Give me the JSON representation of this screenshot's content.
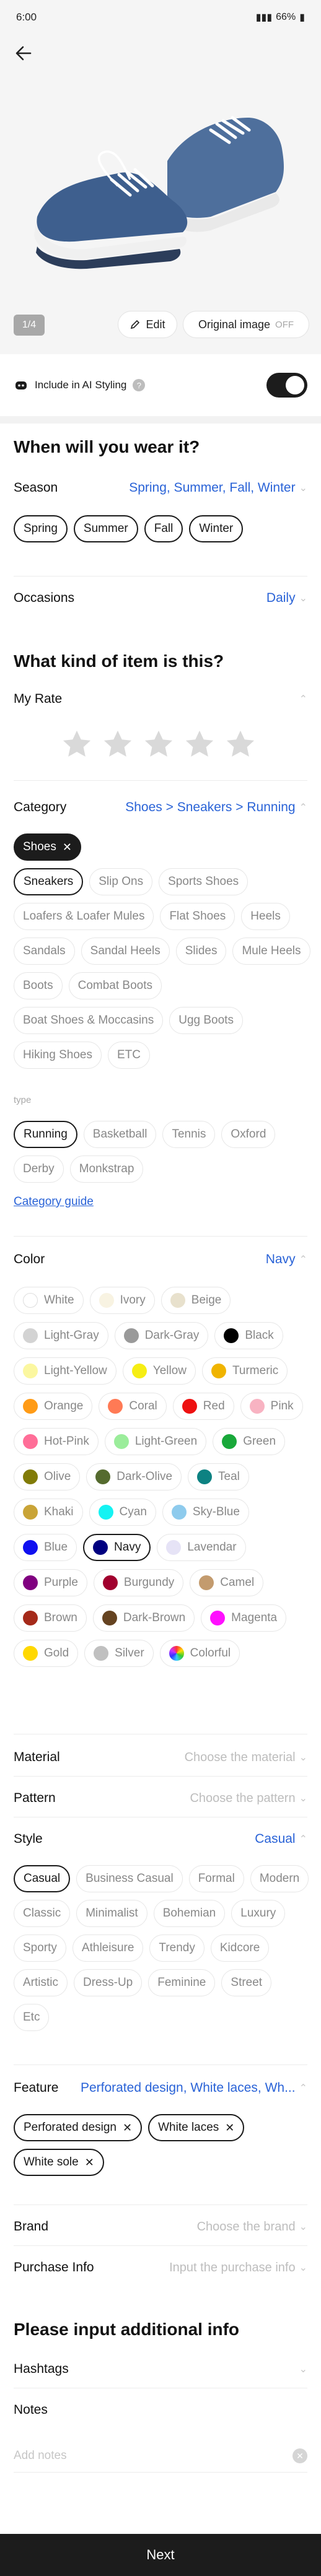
{
  "status": {
    "time": "6:00",
    "battery": "66%"
  },
  "hero": {
    "counter": "1/4",
    "edit": "Edit",
    "original": "Original image",
    "original_state": "OFF"
  },
  "ai": {
    "label": "Include in AI Styling",
    "help": "?"
  },
  "wear": {
    "heading": "When will you wear it?",
    "season_label": "Season",
    "season_value": "Spring, Summer, Fall, Winter",
    "seasons": [
      "Spring",
      "Summer",
      "Fall",
      "Winter"
    ],
    "occasions_label": "Occasions",
    "occasions_value": "Daily"
  },
  "kind": {
    "heading": "What kind of item is this?",
    "rate_label": "My Rate",
    "rating": 0,
    "rating_max": 5
  },
  "category": {
    "label": "Category",
    "value": "Shoes > Sneakers > Running",
    "top": "Shoes",
    "subs": [
      "Sneakers",
      "Slip Ons",
      "Sports Shoes",
      "Loafers & Loafer Mules",
      "Flat Shoes",
      "Heels",
      "Sandals",
      "Sandal Heels",
      "Slides",
      "Mule Heels",
      "Boots",
      "Combat Boots",
      "Boat Shoes & Moccasins",
      "Ugg Boots",
      "Hiking Shoes",
      "ETC"
    ],
    "sub_selected": "Sneakers",
    "type_label": "type",
    "types": [
      "Running",
      "Basketball",
      "Tennis",
      "Oxford",
      "Derby",
      "Monkstrap"
    ],
    "type_selected": "Running",
    "guide": "Category guide"
  },
  "color": {
    "label": "Color",
    "value": "Navy",
    "selected": "Navy",
    "items": [
      {
        "name": "White",
        "hex": "#ffffff"
      },
      {
        "name": "Ivory",
        "hex": "#f8f3e2"
      },
      {
        "name": "Beige",
        "hex": "#e8e1cd"
      },
      {
        "name": "Light-Gray",
        "hex": "#d3d3d3"
      },
      {
        "name": "Dark-Gray",
        "hex": "#9a9a9a"
      },
      {
        "name": "Black",
        "hex": "#000000"
      },
      {
        "name": "Light-Yellow",
        "hex": "#fbf7a0"
      },
      {
        "name": "Yellow",
        "hex": "#f6ee14"
      },
      {
        "name": "Turmeric",
        "hex": "#f0b400"
      },
      {
        "name": "Orange",
        "hex": "#ff9b16"
      },
      {
        "name": "Coral",
        "hex": "#ff7a55"
      },
      {
        "name": "Red",
        "hex": "#ee1111"
      },
      {
        "name": "Pink",
        "hex": "#f8b3c2"
      },
      {
        "name": "Hot-Pink",
        "hex": "#ff6e98"
      },
      {
        "name": "Light-Green",
        "hex": "#9bed9b"
      },
      {
        "name": "Green",
        "hex": "#19a83a"
      },
      {
        "name": "Olive",
        "hex": "#817b07"
      },
      {
        "name": "Dark-Olive",
        "hex": "#556b2f"
      },
      {
        "name": "Teal",
        "hex": "#0d8282"
      },
      {
        "name": "Khaki",
        "hex": "#c9a437"
      },
      {
        "name": "Cyan",
        "hex": "#14f3f3"
      },
      {
        "name": "Sky-Blue",
        "hex": "#8ecbed"
      },
      {
        "name": "Blue",
        "hex": "#1010f0"
      },
      {
        "name": "Navy",
        "hex": "#000080"
      },
      {
        "name": "Lavendar",
        "hex": "#e6e3f6"
      },
      {
        "name": "Purple",
        "hex": "#800080"
      },
      {
        "name": "Burgundy",
        "hex": "#a1002e"
      },
      {
        "name": "Camel",
        "hex": "#c39b6e"
      },
      {
        "name": "Brown",
        "hex": "#a52a1a"
      },
      {
        "name": "Dark-Brown",
        "hex": "#654321"
      },
      {
        "name": "Magenta",
        "hex": "#ff10ff"
      },
      {
        "name": "Gold",
        "hex": "#ffd800"
      },
      {
        "name": "Silver",
        "hex": "#c0c0c0"
      },
      {
        "name": "Colorful",
        "hex": "conic"
      }
    ]
  },
  "material": {
    "label": "Material",
    "placeholder": "Choose the material"
  },
  "pattern": {
    "label": "Pattern",
    "placeholder": "Choose the pattern"
  },
  "style": {
    "label": "Style",
    "value": "Casual",
    "selected": "Casual",
    "items": [
      "Casual",
      "Business Casual",
      "Formal",
      "Modern",
      "Classic",
      "Minimalist",
      "Bohemian",
      "Luxury",
      "Sporty",
      "Athleisure",
      "Trendy",
      "Kidcore",
      "Artistic",
      "Dress-Up",
      "Feminine",
      "Street",
      "Etc"
    ]
  },
  "feature": {
    "label": "Feature",
    "value": "Perforated design, White laces, Wh...",
    "items": [
      "Perforated design",
      "White laces",
      "White sole"
    ]
  },
  "brand": {
    "label": "Brand",
    "placeholder": "Choose the brand"
  },
  "purchase": {
    "label": "Purchase Info",
    "placeholder": "Input the purchase info"
  },
  "additional": {
    "heading": "Please input additional info",
    "hashtags_label": "Hashtags",
    "notes_label": "Notes",
    "notes_placeholder": "Add notes"
  },
  "footer": {
    "next": "Next"
  },
  "accent": "#2a63d7"
}
